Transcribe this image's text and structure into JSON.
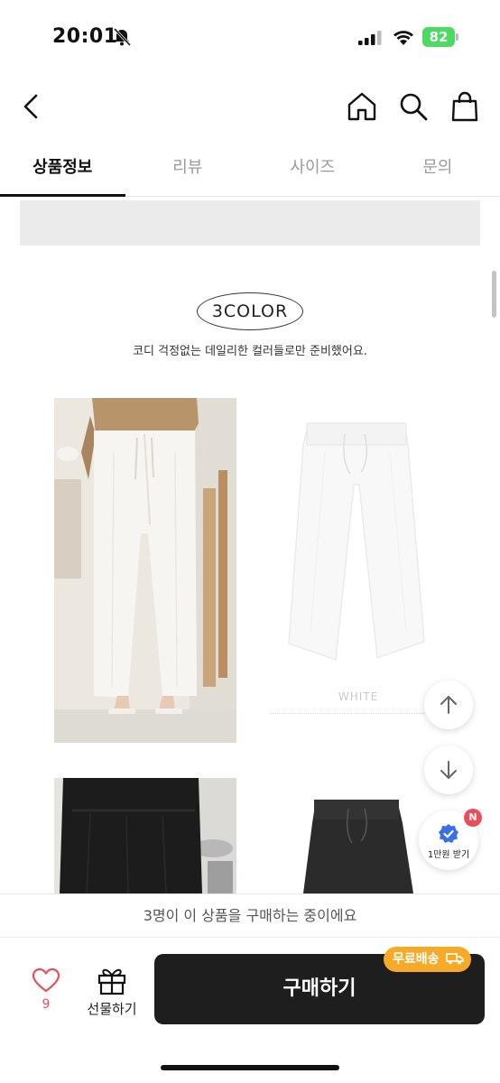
{
  "status": {
    "time": "20:01",
    "battery": "82"
  },
  "tabs": [
    {
      "label": "상품정보"
    },
    {
      "label": "리뷰"
    },
    {
      "label": "사이즈"
    },
    {
      "label": "문의"
    }
  ],
  "content": {
    "color_title": "3COLOR",
    "color_desc": "코디 걱정없는 데일리한 컬러들로만 준비했어요.",
    "white_label": "WHITE"
  },
  "coupon": {
    "badge": "N",
    "label": "1만원 받기"
  },
  "social_proof": "3명이 이 상품을 구매하는 중이에요",
  "bottom_bar": {
    "like_count": "9",
    "gift_label": "선물하기",
    "buy_label": "구매하기",
    "free_shipping_label": "무료배송"
  },
  "colors": {
    "accent_red": "#e94e5b",
    "free_shipping": "#f7a928",
    "buy_button": "#1e1e1e",
    "coupon_check": "#3a6fe8"
  }
}
